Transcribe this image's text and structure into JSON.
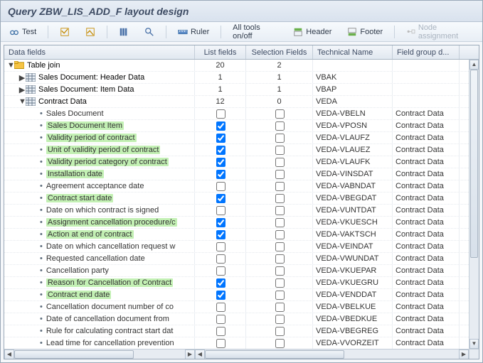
{
  "title": "Query ZBW_LIS_ADD_F layout design",
  "toolbar": {
    "test": "Test",
    "ruler": "Ruler",
    "alltools": "All tools on/off",
    "header": "Header",
    "footer": "Footer",
    "node": "Node assignment"
  },
  "headers": {
    "tree": "Data fields",
    "list": "List fields",
    "sel": "Selection Fields",
    "tech": "Technical Name",
    "grp": "Field group d..."
  },
  "root": {
    "label": "Table join",
    "list": "20",
    "sel": "2"
  },
  "tables": [
    {
      "label": "Sales Document: Header Data",
      "list": "1",
      "sel": "1",
      "tech": "VBAK",
      "open": false
    },
    {
      "label": "Sales Document: Item Data",
      "list": "1",
      "sel": "1",
      "tech": "VBAP",
      "open": false
    },
    {
      "label": "Contract Data",
      "list": "12",
      "sel": "0",
      "tech": "VEDA",
      "open": true
    }
  ],
  "fields": [
    {
      "label": "Sales Document",
      "hl": false,
      "list": false,
      "tech": "VEDA-VBELN"
    },
    {
      "label": "Sales Document Item",
      "hl": true,
      "list": true,
      "tech": "VEDA-VPOSN"
    },
    {
      "label": "Validity period of contract",
      "hl": true,
      "list": true,
      "tech": "VEDA-VLAUFZ"
    },
    {
      "label": "Unit of validity period of contract",
      "hl": true,
      "list": true,
      "tech": "VEDA-VLAUEZ"
    },
    {
      "label": "Validity period category of contract",
      "hl": true,
      "list": true,
      "tech": "VEDA-VLAUFK"
    },
    {
      "label": "Installation date",
      "hl": true,
      "list": true,
      "tech": "VEDA-VINSDAT"
    },
    {
      "label": "Agreement acceptance date",
      "hl": false,
      "list": false,
      "tech": "VEDA-VABNDAT"
    },
    {
      "label": "Contract start date",
      "hl": true,
      "list": true,
      "tech": "VEDA-VBEGDAT"
    },
    {
      "label": "Date on which contract is signed",
      "hl": false,
      "list": false,
      "tech": "VEDA-VUNTDAT"
    },
    {
      "label": "Assignment cancellation procedure/c",
      "hl": true,
      "list": true,
      "tech": "VEDA-VKUESCH"
    },
    {
      "label": "Action at end of contract",
      "hl": true,
      "list": true,
      "tech": "VEDA-VAKTSCH"
    },
    {
      "label": "Date on which cancellation request w",
      "hl": false,
      "list": false,
      "tech": "VEDA-VEINDAT"
    },
    {
      "label": "Requested cancellation date",
      "hl": false,
      "list": false,
      "tech": "VEDA-VWUNDAT"
    },
    {
      "label": "Cancellation party",
      "hl": false,
      "list": false,
      "tech": "VEDA-VKUEPAR"
    },
    {
      "label": "Reason for Cancellation of Contract",
      "hl": true,
      "list": true,
      "tech": "VEDA-VKUEGRU"
    },
    {
      "label": "Contract end date",
      "hl": true,
      "list": true,
      "tech": "VEDA-VENDDAT"
    },
    {
      "label": "Cancellation document number of co",
      "hl": false,
      "list": false,
      "tech": "VEDA-VBELKUE"
    },
    {
      "label": "Date of cancellation document from",
      "hl": false,
      "list": false,
      "tech": "VEDA-VBEDKUE"
    },
    {
      "label": "Rule for calculating contract start dat",
      "hl": false,
      "list": false,
      "tech": "VEDA-VBEGREG"
    },
    {
      "label": "Lead time for cancellation prevention",
      "hl": false,
      "list": false,
      "tech": "VEDA-VVORZEIT"
    }
  ],
  "field_group": "Contract Data"
}
